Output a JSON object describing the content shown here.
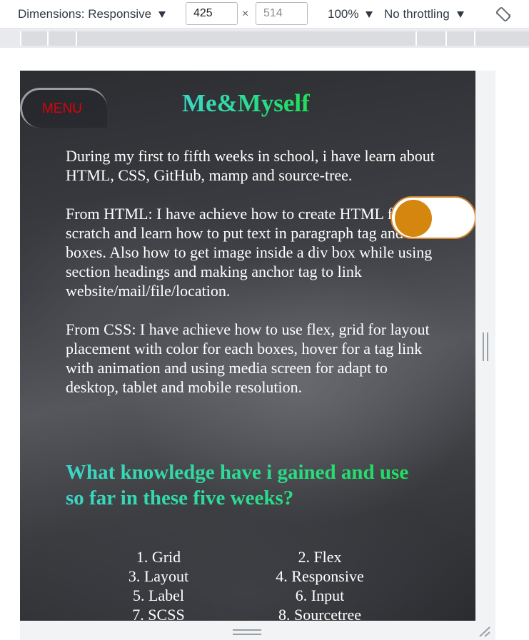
{
  "devtools": {
    "dimensions_label": "Dimensions: Responsive",
    "width_value": "425",
    "height_placeholder": "514",
    "times_symbol": "×",
    "zoom": "100%",
    "throttling": "No throttling",
    "rotate_icon": "rotate-device-icon"
  },
  "page": {
    "menu_label": "MENU",
    "title": "Me&Myself",
    "paragraphs": [
      "During my first to fifth weeks in school, i have learn about HTML, CSS, GitHub, mamp and source-tree.",
      "From HTML: I have achieve how to create HTML from scratch and learn how to put text in paragraph tag and div boxes. Also how to get image inside a div box while using section headings and making anchor tag to link website/mail/file/location.",
      "From CSS: I have achieve how to use flex, grid for layout placement with color for each boxes, hover for a tag link with animation and using media screen for adapt to desktop, tablet and mobile resolution."
    ],
    "toggle_state": "off",
    "section_heading": "What knowledge have i gained and use so far in these five weeks?",
    "knowledge_list_left": [
      "1. Grid",
      "3. Layout",
      "5. Label",
      "7. SCSS"
    ],
    "knowledge_list_right": [
      "2. Flex",
      "4. Responsive",
      "6. Input",
      "8. Sourcetree"
    ]
  },
  "colors": {
    "title_gradient_start": "#3ad7c8",
    "title_gradient_end": "#1ee05a",
    "menu_text": "#e0000a",
    "toggle_knob": "#d5860e",
    "body_text": "#ffffff"
  }
}
